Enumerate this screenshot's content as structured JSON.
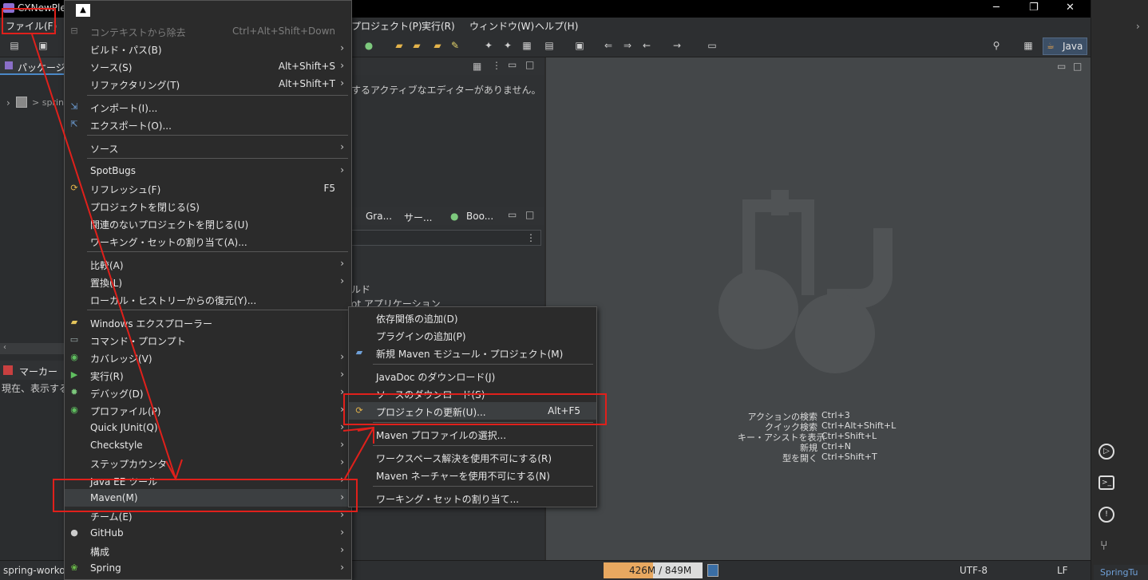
{
  "window": {
    "title": "CXNewPle"
  },
  "menubar": {
    "file": "ファイル(F)",
    "project": "プロジェクト(P)",
    "run": "実行(R)",
    "window": "ウィンドウ(W)",
    "help": "ヘルプ(H)"
  },
  "toolbar": {
    "perspective": "Java"
  },
  "left": {
    "package_tab": "パッケージ・エ",
    "tree_item": "> sprin",
    "marker_tab": "マーカー",
    "marker_text": "現在、表示する"
  },
  "editor": {
    "no_editor": "するアクティブなエディターがありません。",
    "tabs": [
      "Gra...",
      "サー...",
      "Boo..."
    ],
    "partial1": "ルド",
    "partial2": "ot アプリケーション"
  },
  "hints": {
    "labels": [
      "アクションの検索",
      "クイック検索",
      "キー・アシストを表示",
      "新規",
      "型を開く"
    ],
    "keys": [
      "Ctrl+3",
      "Ctrl+Alt+Shift+L",
      "Ctrl+Shift+L",
      "Ctrl+N",
      "Ctrl+Shift+T"
    ]
  },
  "file_menu": [
    {
      "label": "コンテキストから除去",
      "shortcut": "Ctrl+Alt+Shift+Down",
      "disabled": true,
      "icon": "remove-context-icon"
    },
    {
      "label": "ビルド・パス(B)",
      "submenu": true
    },
    {
      "label": "ソース(S)",
      "shortcut": "Alt+Shift+S",
      "submenu": true
    },
    {
      "label": "リファクタリング(T)",
      "shortcut": "Alt+Shift+T",
      "submenu": true
    },
    {
      "label": "インポート(I)...",
      "icon": "import-icon"
    },
    {
      "label": "エクスポート(O)...",
      "icon": "export-icon"
    },
    {
      "label": "ソース",
      "submenu": true
    },
    {
      "label": "SpotBugs",
      "submenu": true
    },
    {
      "label": "リフレッシュ(F)",
      "shortcut": "F5",
      "icon": "refresh-icon"
    },
    {
      "label": "プロジェクトを閉じる(S)"
    },
    {
      "label": "関連のないプロジェクトを閉じる(U)"
    },
    {
      "label": "ワーキング・セットの割り当て(A)..."
    },
    {
      "label": "比較(A)",
      "submenu": true
    },
    {
      "label": "置換(L)",
      "submenu": true
    },
    {
      "label": "ローカル・ヒストリーからの復元(Y)..."
    },
    {
      "label": "Windows エクスプローラー",
      "icon": "folder-icon"
    },
    {
      "label": "コマンド・プロンプト",
      "icon": "terminal-icon"
    },
    {
      "label": "カバレッジ(V)",
      "submenu": true,
      "icon": "coverage-icon"
    },
    {
      "label": "実行(R)",
      "submenu": true,
      "icon": "run-icon"
    },
    {
      "label": "デバッグ(D)",
      "submenu": true,
      "icon": "debug-icon"
    },
    {
      "label": "プロファイル(P)",
      "submenu": true,
      "icon": "profile-icon"
    },
    {
      "label": "Quick JUnit(Q)",
      "submenu": true
    },
    {
      "label": "Checkstyle",
      "submenu": true
    },
    {
      "label": "ステップカウンタ",
      "submenu": true
    },
    {
      "label": "Java EE ツール",
      "submenu": true
    },
    {
      "label": "Maven(M)",
      "submenu": true
    },
    {
      "label": "チーム(E)",
      "submenu": true
    },
    {
      "label": "GitHub",
      "submenu": true,
      "icon": "github-icon"
    },
    {
      "label": "構成",
      "submenu": true
    },
    {
      "label": "Spring",
      "submenu": true,
      "icon": "spring-icon"
    }
  ],
  "maven_menu": [
    {
      "label": "依存関係の追加(D)"
    },
    {
      "label": "プラグインの追加(P)"
    },
    {
      "label": "新規 Maven モジュール・プロジェクト(M)",
      "icon": "new-module-icon"
    },
    {
      "label": "JavaDoc のダウンロード(J)"
    },
    {
      "label": "ソースのダウンロード(S)"
    },
    {
      "label": "プロジェクトの更新(U)...",
      "shortcut": "Alt+F5",
      "icon": "update-project-icon"
    },
    {
      "label": "Maven プロファイルの選択..."
    },
    {
      "label": "ワークスペース解決を使用不可にする(R)"
    },
    {
      "label": "Maven ネーチャーを使用不可にする(N)"
    },
    {
      "label": "ワーキング・セットの割り当て..."
    }
  ],
  "statusbar": {
    "workspace": "spring-workou",
    "heap": "426M / 849M",
    "encoding": "UTF-8",
    "line_ending": "LF",
    "right": "SpringTu"
  },
  "colors": {
    "annotation_red": "#e0201b",
    "heap_fill": "#e8a860"
  }
}
